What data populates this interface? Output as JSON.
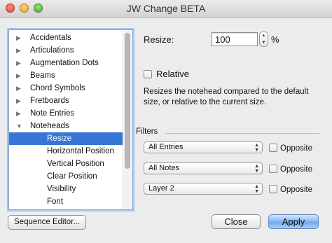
{
  "window": {
    "title": "JW Change BETA"
  },
  "tree": {
    "items": [
      {
        "label": "Accidentals",
        "state": "collapsed",
        "level": 0,
        "selected": false
      },
      {
        "label": "Articulations",
        "state": "collapsed",
        "level": 0,
        "selected": false
      },
      {
        "label": "Augmentation Dots",
        "state": "collapsed",
        "level": 0,
        "selected": false
      },
      {
        "label": "Beams",
        "state": "collapsed",
        "level": 0,
        "selected": false
      },
      {
        "label": "Chord Symbols",
        "state": "collapsed",
        "level": 0,
        "selected": false
      },
      {
        "label": "Fretboards",
        "state": "collapsed",
        "level": 0,
        "selected": false
      },
      {
        "label": "Note Entries",
        "state": "collapsed",
        "level": 0,
        "selected": false
      },
      {
        "label": "Noteheads",
        "state": "expanded",
        "level": 0,
        "selected": false
      },
      {
        "label": "Resize",
        "state": "leaf",
        "level": 1,
        "selected": true
      },
      {
        "label": "Horizontal Position",
        "state": "leaf",
        "level": 1,
        "selected": false
      },
      {
        "label": "Vertical Position",
        "state": "leaf",
        "level": 1,
        "selected": false
      },
      {
        "label": "Clear Position",
        "state": "leaf",
        "level": 1,
        "selected": false
      },
      {
        "label": "Visibility",
        "state": "leaf",
        "level": 1,
        "selected": false
      },
      {
        "label": "Font",
        "state": "leaf",
        "level": 1,
        "selected": false
      }
    ]
  },
  "resize": {
    "label": "Resize:",
    "value": "100",
    "unit": "%"
  },
  "relative": {
    "label": "Relative",
    "checked": false
  },
  "description": "Resizes the notehead compared to the default size, or relative to the current size.",
  "filters": {
    "label": "Filters",
    "rows": [
      {
        "selected": "All Entries",
        "opposite_label": "Opposite",
        "opposite_checked": false
      },
      {
        "selected": "All Notes",
        "opposite_label": "Opposite",
        "opposite_checked": false
      },
      {
        "selected": "Layer 2",
        "opposite_label": "Opposite",
        "opposite_checked": false
      }
    ]
  },
  "buttons": {
    "sequence_editor": "Sequence Editor...",
    "close": "Close",
    "apply": "Apply"
  },
  "colors": {
    "selection": "#3875d7",
    "focus_ring": "#7aa2d6",
    "default_button": "#6fa6ea"
  },
  "icons": {
    "collapsed": "disclosure-triangle-right",
    "expanded": "disclosure-triangle-down",
    "popup": "updown-arrows",
    "stepper": "stepper-arrows"
  }
}
